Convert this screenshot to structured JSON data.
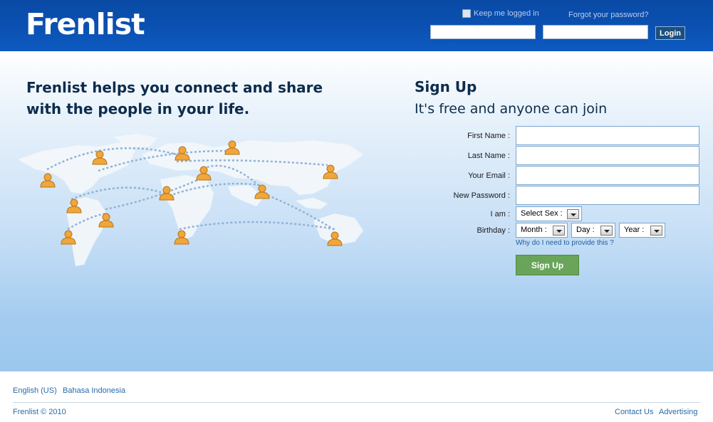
{
  "header": {
    "logo": "Frenlist",
    "keep_logged_in": "Keep me logged in",
    "forgot_password": "Forgot your password?",
    "login_label": "Login",
    "email_value": "",
    "password_value": ""
  },
  "main": {
    "tagline": "Frenlist helps you connect and share with the people in your life."
  },
  "signup": {
    "title": "Sign Up",
    "subtitle": "It's free and anyone can join",
    "fields": {
      "first_name": "First Name :",
      "last_name": "Last Name :",
      "email": "Your Email :",
      "password": "New Password :",
      "sex_label": "I am :",
      "birthday_label": "Birthday :"
    },
    "sex_select": "Select Sex :",
    "month_select": "Month :",
    "day_select": "Day :",
    "year_select": "Year :",
    "why_link": "Why do I need to provide this ?",
    "button_label": "Sign Up"
  },
  "footer": {
    "lang_english": "English (US)",
    "lang_indonesian": "Bahasa Indonesia",
    "copyright": "Frenlist © 2010",
    "contact": "Contact Us",
    "advertising": "Advertising"
  },
  "colors": {
    "header_bg": "#0b52b4",
    "signup_button": "#69a45a",
    "person_icon": "#f0a63a",
    "link": "#2a6aa8"
  }
}
